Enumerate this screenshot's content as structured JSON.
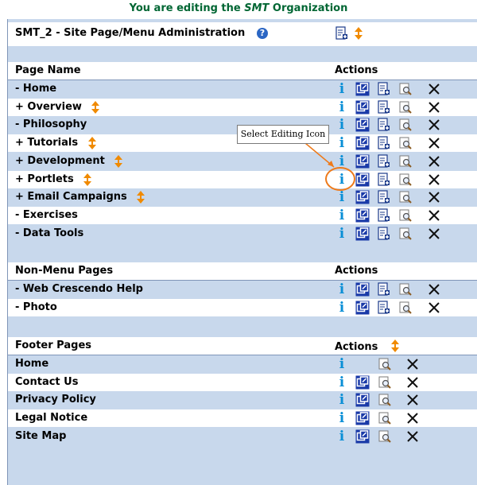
{
  "banner": {
    "prefix": "You are editing the ",
    "org": "SMT",
    "suffix": " Organization"
  },
  "title": "SMT_2 - Site Page/Menu Administration",
  "colors": {
    "banner": "#006633",
    "row_blue": "#c8d8ec",
    "info": "#0a8fd6",
    "callout_circle": "#ee7a1a"
  },
  "menu_section": {
    "col_page": "Page Name",
    "col_actions": "Actions",
    "rows": [
      {
        "label": "- Home",
        "arrows": false
      },
      {
        "label": "+  Overview",
        "arrows": true
      },
      {
        "label": "- Philosophy",
        "arrows": false
      },
      {
        "label": "+  Tutorials",
        "arrows": true
      },
      {
        "label": "+  Development",
        "arrows": true
      },
      {
        "label": "+  Portlets",
        "arrows": true
      },
      {
        "label": "+  Email Campaigns",
        "arrows": true
      },
      {
        "label": "- Exercises",
        "arrows": false
      },
      {
        "label": "- Data Tools",
        "arrows": false
      }
    ]
  },
  "nonmenu_section": {
    "col_page": "Non-Menu Pages",
    "col_actions": "Actions",
    "rows": [
      {
        "label": "- Web Crescendo Help"
      },
      {
        "label": "- Photo"
      }
    ]
  },
  "footer_section": {
    "col_page": "Footer Pages",
    "col_actions": "Actions",
    "rows": [
      {
        "label": "Home",
        "edit": false
      },
      {
        "label": "Contact Us",
        "edit": true
      },
      {
        "label": "Privacy Policy",
        "edit": true
      },
      {
        "label": "Legal Notice",
        "edit": true
      },
      {
        "label": "Site Map",
        "edit": true
      }
    ]
  },
  "callout": "Select Editing Icon",
  "icons": [
    "info-icon",
    "edit-page-icon",
    "add-page-icon",
    "preview-icon",
    "delete-icon",
    "reorder-arrows-icon",
    "help-icon"
  ]
}
